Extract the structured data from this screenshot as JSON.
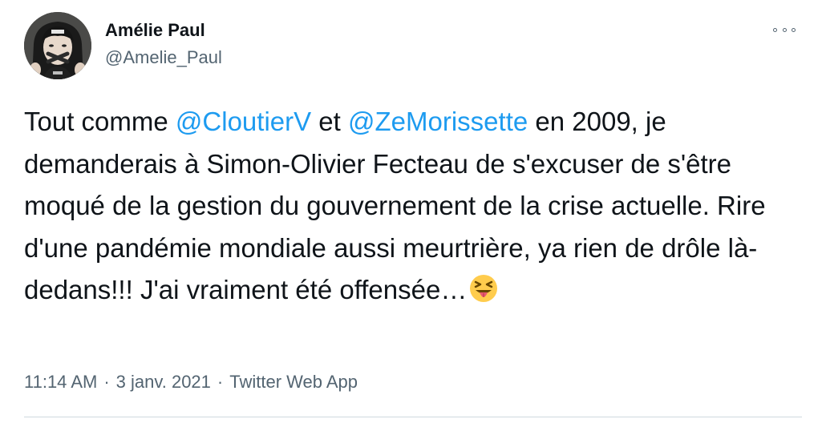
{
  "author": {
    "name": "Amélie Paul",
    "handle": "@Amelie_Paul"
  },
  "tweet": {
    "part1": "Tout comme ",
    "mention1": "@CloutierV",
    "part2": " et ",
    "mention2": "@ZeMorissette",
    "part3": " en 2009, je demanderais à Simon-Olivier Fecteau de s'excuser de s'être moqué de la gestion du gouvernement de la crise actuelle. Rire d'une pandémie mondiale aussi meurtrière, ya rien de drôle là-dedans!!! J'ai vraiment été offensée…",
    "emoji": "squinting-face-with-tongue-icon"
  },
  "meta": {
    "time": "11:14 AM",
    "separator": "·",
    "date": "3 janv. 2021",
    "source": "Twitter Web App"
  },
  "icons": {
    "more": "more-options-icon"
  },
  "colors": {
    "link": "#1d9bf0",
    "secondary_text": "#536471",
    "primary_text": "#0f1419",
    "divider": "#cfd9de"
  }
}
